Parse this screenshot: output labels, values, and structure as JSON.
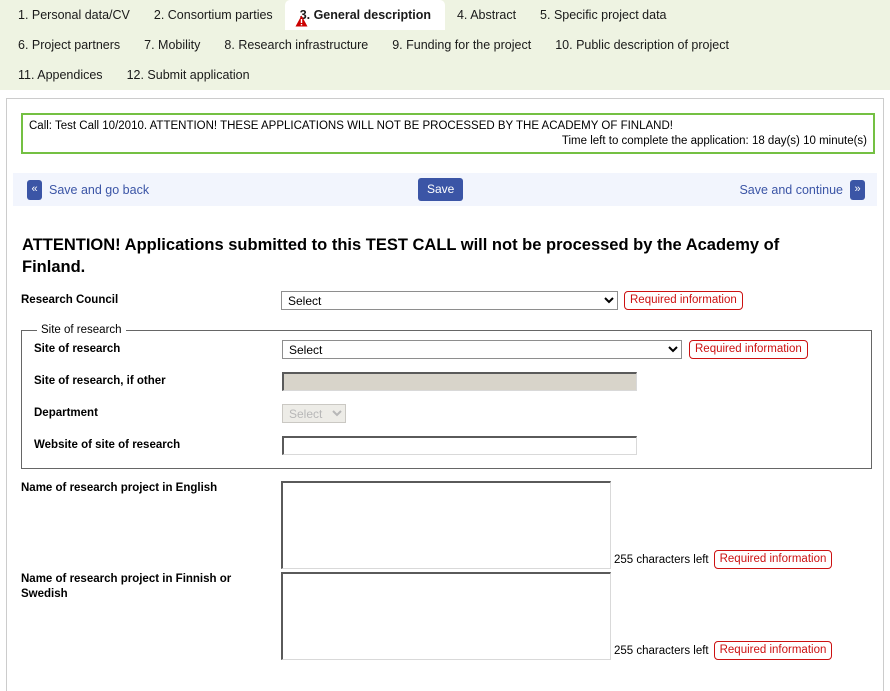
{
  "tabs": [
    {
      "label": "1. Personal data/CV",
      "active": false,
      "warning": false
    },
    {
      "label": "2. Consortium parties",
      "active": false,
      "warning": false
    },
    {
      "label": "3. General description",
      "active": true,
      "warning": true
    },
    {
      "label": "4. Abstract",
      "active": false,
      "warning": false
    },
    {
      "label": "5. Specific project data",
      "active": false,
      "warning": false
    },
    {
      "label": "6. Project partners",
      "active": false,
      "warning": false
    },
    {
      "label": "7. Mobility",
      "active": false,
      "warning": false
    },
    {
      "label": "8. Research infrastructure",
      "active": false,
      "warning": false
    },
    {
      "label": "9. Funding for the project",
      "active": false,
      "warning": false
    },
    {
      "label": "10. Public description of project",
      "active": false,
      "warning": false
    },
    {
      "label": "11. Appendices",
      "active": false,
      "warning": false
    },
    {
      "label": "12. Submit application",
      "active": false,
      "warning": false
    }
  ],
  "call_box": {
    "line1": "Call: Test Call 10/2010. ATTENTION! THESE APPLICATIONS WILL NOT BE PROCESSED BY THE ACADEMY OF FINLAND!",
    "line2": "Time left to complete the application: 18 day(s) 10 minute(s)",
    "border_color": "#74c043"
  },
  "toolbar": {
    "back_arrow": "«",
    "back_label": "Save and go back",
    "save_label": "Save",
    "continue_label": "Save and continue",
    "forward_arrow": "»",
    "accent_color": "#3b55a6",
    "background_color": "#f2f5fd"
  },
  "page_title": "ATTENTION! Applications submitted to this TEST CALL will not be processed by the Academy of Finland.",
  "required_badge": "Required information",
  "fields": {
    "research_council": {
      "label": "Research Council",
      "value": "Select",
      "options": [
        "Select"
      ],
      "required": true
    }
  },
  "site_fieldset": {
    "legend": "Site of research",
    "rows": [
      {
        "label": "Site of research",
        "type": "select",
        "value": "Select",
        "options": [
          "Select"
        ],
        "disabled": false,
        "required": true
      },
      {
        "label": "Site of research, if other",
        "type": "text",
        "value": "",
        "disabled": true,
        "required": false
      },
      {
        "label": "Department",
        "type": "select",
        "value": "Select",
        "options": [
          "Select"
        ],
        "disabled": true,
        "required": false
      },
      {
        "label": "Website of site of research",
        "type": "text",
        "value": "",
        "disabled": false,
        "required": false
      }
    ]
  },
  "textareas": [
    {
      "label": "Name of research project in English",
      "value": "",
      "chars_left": "255 characters left",
      "required": true
    },
    {
      "label": "Name of research project in Finnish or Swedish",
      "value": "",
      "chars_left": "255 characters left",
      "required": true
    }
  ],
  "colors": {
    "tabbar_background": "#eef3e2",
    "required_red": "#cc1111",
    "warning_red": "#cc0000"
  }
}
